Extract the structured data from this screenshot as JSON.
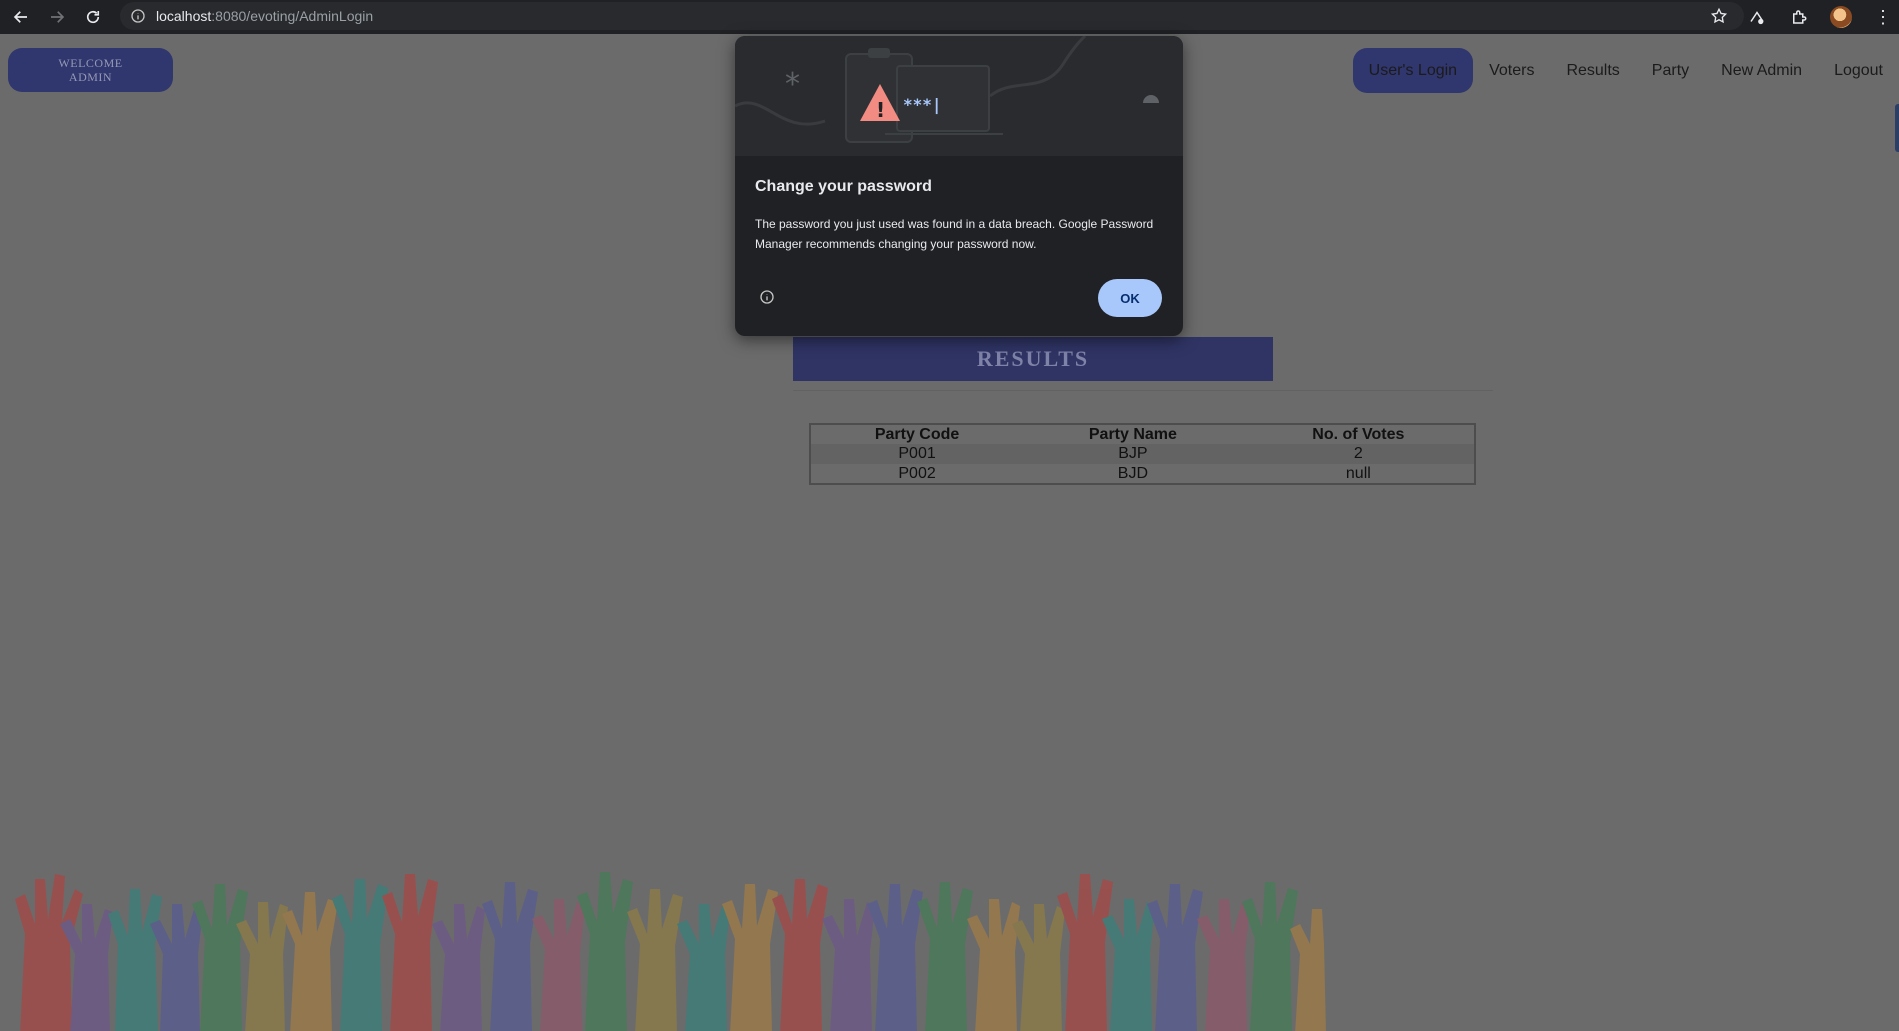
{
  "browser": {
    "url_host": "localhost",
    "url_rest": ":8080/evoting/AdminLogin"
  },
  "header": {
    "welcome_line1": "WELCOME",
    "welcome_line2": "ADMIN"
  },
  "nav": {
    "items": [
      {
        "label": "User's Login",
        "active": true
      },
      {
        "label": "Voters"
      },
      {
        "label": "Results"
      },
      {
        "label": "Party"
      },
      {
        "label": "New Admin"
      },
      {
        "label": "Logout"
      }
    ]
  },
  "main": {
    "results_title": "RESULTS",
    "table": {
      "headers": [
        "Party Code",
        "Party Name",
        "No. of Votes"
      ],
      "rows": [
        [
          "P001",
          "BJP",
          "2"
        ],
        [
          "P002",
          "BJD",
          "null"
        ]
      ]
    }
  },
  "dialog": {
    "title": "Change your password",
    "body": "The password you just used was found in a data breach. Google Password Manager recommends changing your password now.",
    "ok_label": "OK",
    "masked_text": "***|"
  },
  "colors": {
    "accent": "#30366e",
    "dialog_button": "#a8c7fa"
  }
}
